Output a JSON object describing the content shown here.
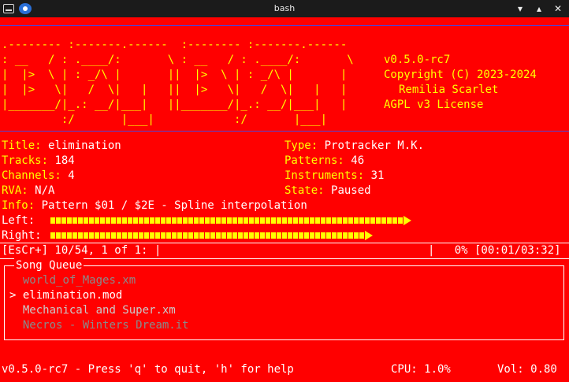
{
  "window": {
    "title": "bash"
  },
  "window_buttons": {
    "min": "▾",
    "max": "▴",
    "close": "✕"
  },
  "banner": {
    "art": [
      ".-------- :-------.------  :-------- :-------.------",
      ": __   / : .____/:       \\ : __   / : .____/:       \\",
      "|  |>  \\ | : _/\\ |       ||  |>  \\ | : _/\\ |       |",
      "|  |>   \\|   /  \\|   |   ||  |>   \\|   /  \\|   |   |",
      "|_______/|_.: __/|___|   ||_______/|_.: __/|___|   |",
      "         :/       |___|            :/       |___|"
    ],
    "version": "v0.5.0-rc7",
    "copyright": "Copyright (C) 2023-2024",
    "author": "Remilia Scarlet",
    "license": "AGPL v3 License"
  },
  "info": {
    "title_label": "Title:",
    "title_value": "elimination",
    "type_label": "Type:",
    "type_value": "Protracker M.K.",
    "tracks_label": "Tracks:",
    "tracks_value": "184",
    "patterns_label": "Patterns:",
    "patterns_value": "46",
    "channels_label": "Channels:",
    "channels_value": "4",
    "instruments_label": "Instruments:",
    "instruments_value": "31",
    "rva_label": "RVA:",
    "rva_value": "N/A",
    "state_label": "State:",
    "state_value": "Paused",
    "info_label": "Info:",
    "info_value": "Pattern $01 / $2E - Spline interpolation"
  },
  "meters": {
    "left_label": "Left:",
    "right_label": "Right:",
    "left_level": 0.64,
    "right_level": 0.57
  },
  "progress": {
    "left": "[EsCr+] 10/54, 1 of 1: |",
    "right": "|   0% [00:01/03:32]"
  },
  "queue": {
    "title": "Song Queue",
    "items": [
      {
        "marker": " ",
        "name": "world_of_Mages.xm",
        "style": "dim"
      },
      {
        "marker": ">",
        "name": "elimination.mod",
        "style": "white"
      },
      {
        "marker": " ",
        "name": "Mechanical and Super.xm",
        "style": "dim"
      },
      {
        "marker": " ",
        "name": "Necros - Winters Dream.it",
        "style": "dim"
      }
    ]
  },
  "statusbar": {
    "help": "v0.5.0-rc7 - Press 'q' to quit, 'h' for help",
    "cpu": "CPU: 1.0%",
    "vol": "Vol: 0.80"
  }
}
